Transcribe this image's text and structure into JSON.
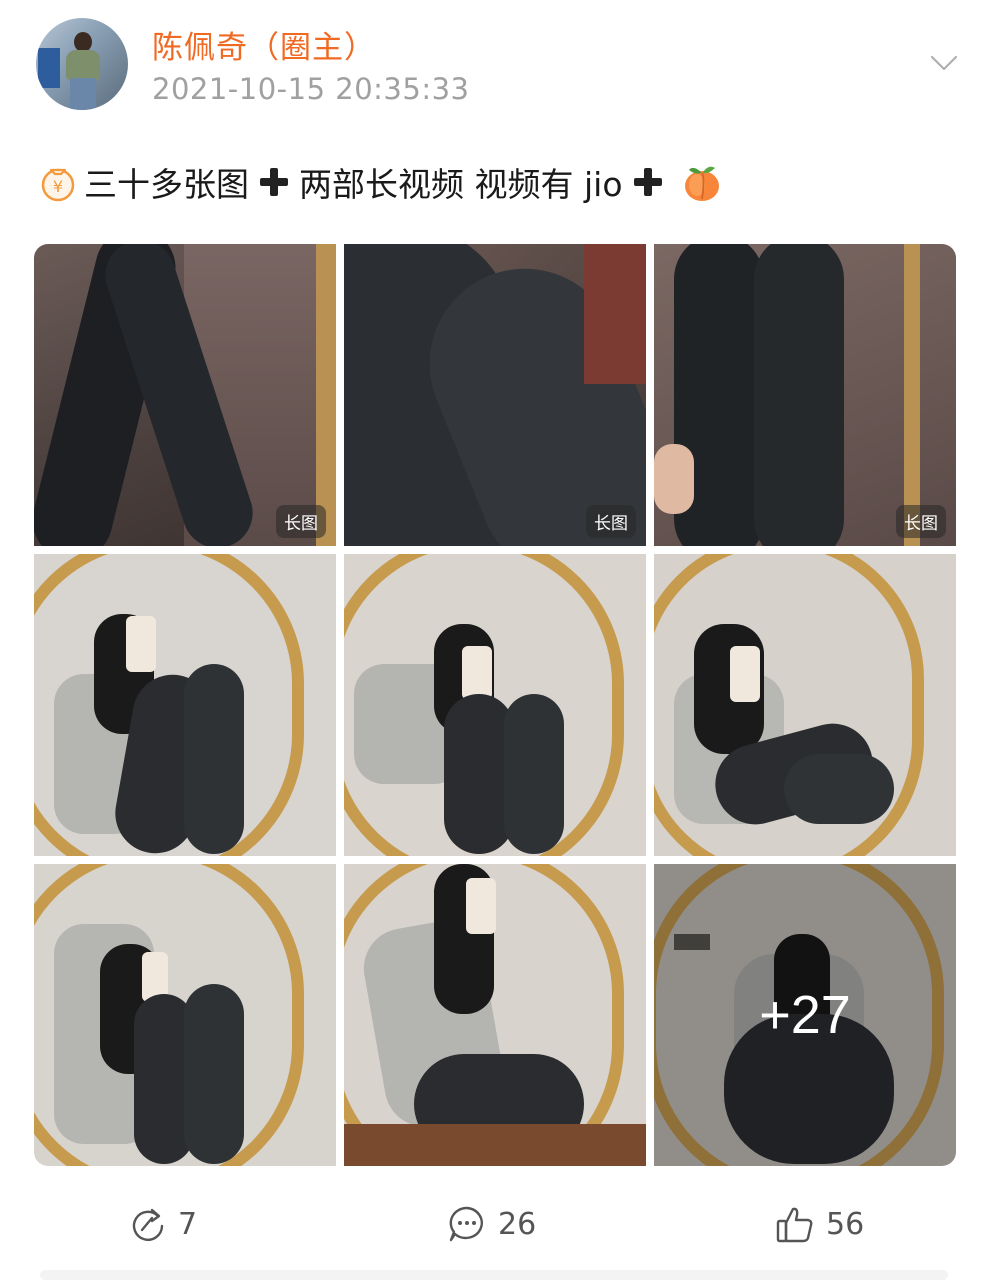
{
  "post": {
    "author": "陈佩奇（圈主）",
    "timestamp": "2021-10-15 20:35:33",
    "text_segments": [
      "三十多张图",
      "两部长视频 视频有 jio"
    ],
    "images": [
      {
        "badge": "长图",
        "icon": "image-legs-1"
      },
      {
        "badge": "长图",
        "icon": "image-legs-2"
      },
      {
        "badge": "长图",
        "icon": "image-legs-3"
      },
      {
        "badge": "",
        "icon": "image-mirror-1"
      },
      {
        "badge": "",
        "icon": "image-mirror-2"
      },
      {
        "badge": "",
        "icon": "image-mirror-3"
      },
      {
        "badge": "",
        "icon": "image-mirror-4"
      },
      {
        "badge": "",
        "icon": "image-mirror-5"
      },
      {
        "badge": "",
        "icon": "image-mirror-6",
        "more_label": "+27"
      }
    ]
  },
  "actions": {
    "repost": {
      "icon": "repost-icon",
      "count": "7"
    },
    "comment": {
      "icon": "comment-icon",
      "count": "26"
    },
    "like": {
      "icon": "like-icon",
      "count": "56"
    }
  },
  "colors": {
    "author": "#f06a24",
    "timestamp": "#a0a0a0",
    "action_text": "#555555"
  }
}
